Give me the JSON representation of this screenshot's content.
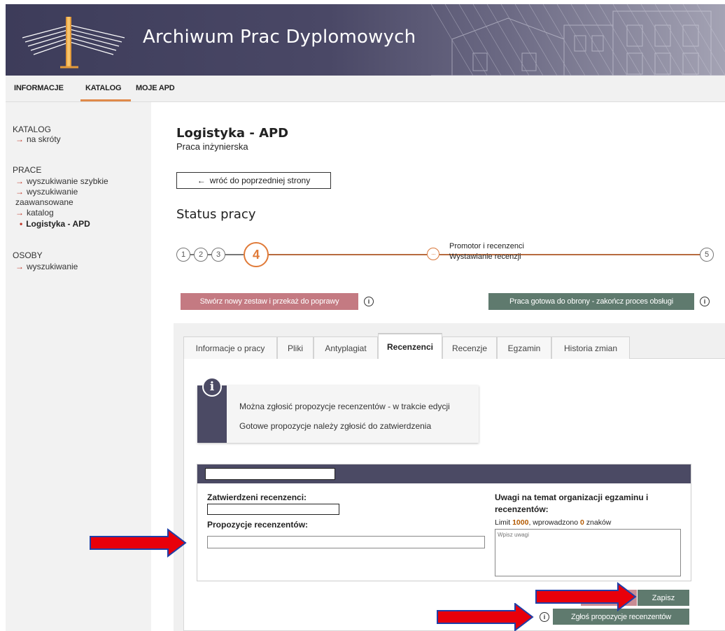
{
  "header": {
    "title": "Archiwum Prac Dyplomowych"
  },
  "topnav": {
    "items": [
      "INFORMACJE",
      "KATALOG",
      "MOJE APD"
    ],
    "active": "KATALOG"
  },
  "sidebar": {
    "katalog_header": "KATALOG",
    "katalog_links": [
      "na skróty"
    ],
    "prace_header": "PRACE",
    "prace_links": [
      "wyszukiwanie szybkie",
      "wyszukiwanie",
      "zaawansowane",
      "katalog"
    ],
    "current": "Logistyka - APD",
    "osoby_header": "OSOBY",
    "osoby_links": [
      "wyszukiwanie"
    ]
  },
  "main": {
    "title": "Logistyka - APD",
    "subtitle": "Praca inżynierska",
    "back_label": "wróć do poprzedniej strony",
    "status_title": "Status pracy",
    "steps": {
      "s1": "1",
      "s2": "2",
      "s3": "3",
      "current": "4",
      "mid": "···",
      "last": "5",
      "label1": "Promotor i recenzenci",
      "label2": "Wystawianie recenzji"
    },
    "btn_return": "Stwórz nowy zestaw i przekaż do poprawy",
    "btn_ready": "Praca gotowa do obrony - zakończ proces obsługi",
    "info_glyph": "i"
  },
  "tabs": [
    "Informacje o pracy",
    "Pliki",
    "Antyplagiat",
    "Recenzenci",
    "Recenzje",
    "Egzamin",
    "Historia zmian"
  ],
  "active_tab": "Recenzenci",
  "infobox": {
    "glyph": "i",
    "line1": "Można zgłosić propozycje recenzentów - w trakcie edycji",
    "line2": "Gotowe propozycje należy zgłosić do zatwierdzenia"
  },
  "form": {
    "approved_label": "Zatwierdzeni recenzenci:",
    "proposals_label": "Propozycje recenzentów:",
    "remarks_label_1": "Uwagi na temat organizacji egzaminu i",
    "remarks_label_2": "recenzentów:",
    "limit_prefix": "Limit ",
    "limit_value": "1000",
    "limit_mid": ", wprowadzono ",
    "limit_count": "0",
    "limit_suffix": " znaków",
    "remarks_placeholder": "Wpisz uwagi"
  },
  "actions": {
    "save": "Zapisz",
    "submit": "Zgłoś propozycje recenzentów"
  },
  "colors": {
    "header": "#4a4866",
    "accent_orange": "#e07a38",
    "green_button": "#5f7a6e",
    "pink_button": "#c47a82",
    "arrow_red": "#e8000b",
    "arrow_blue": "#1f3fa8"
  }
}
